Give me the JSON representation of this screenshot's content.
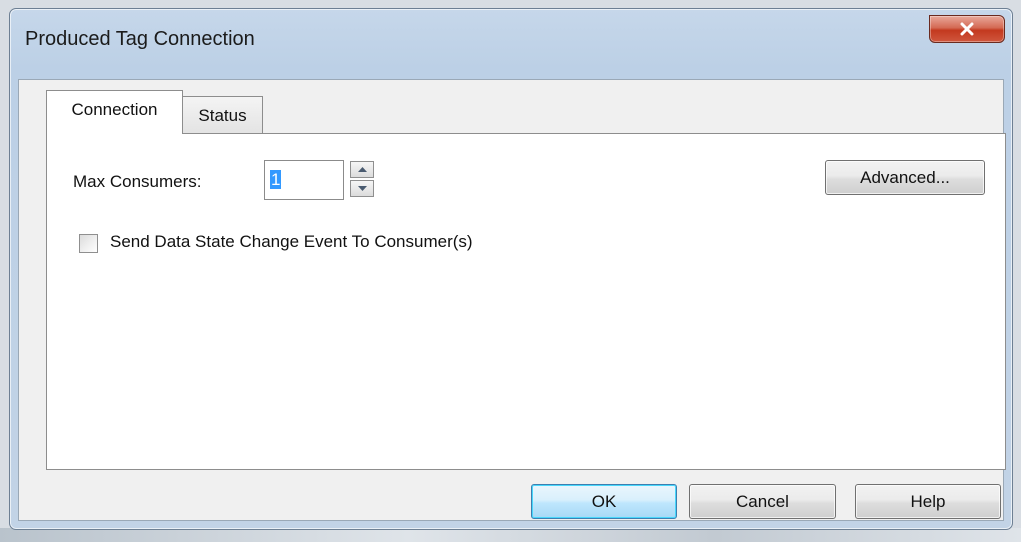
{
  "window": {
    "title": "Produced Tag Connection",
    "close_icon": "close-icon"
  },
  "tabs": [
    {
      "label": "Connection",
      "selected": true
    },
    {
      "label": "Status",
      "selected": false
    }
  ],
  "connection": {
    "max_consumers_label": "Max Consumers:",
    "max_consumers_value": "1",
    "advanced_label": "Advanced...",
    "send_state_change_label": "Send Data State Change Event To Consumer(s)",
    "send_state_change_checked": false
  },
  "buttons": {
    "ok": "OK",
    "cancel": "Cancel",
    "help": "Help"
  },
  "colors": {
    "close_button": "#c3391f",
    "focus_accent": "#3c7fb1",
    "selection": "#3399ff"
  }
}
